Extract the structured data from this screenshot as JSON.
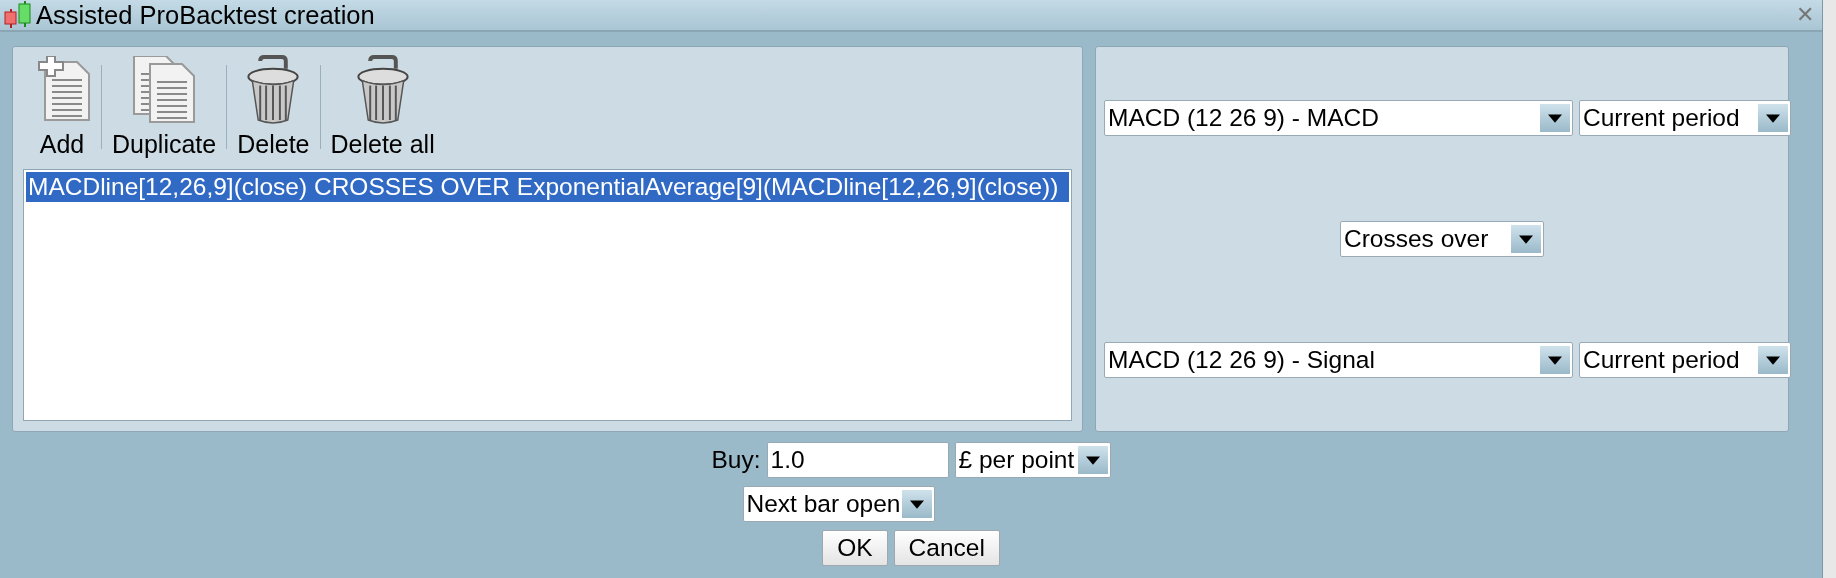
{
  "window": {
    "title": "Assisted ProBacktest creation",
    "close": "✕"
  },
  "toolbar": [
    {
      "kind": "add",
      "label": "Add"
    },
    {
      "kind": "duplicate",
      "label": "Duplicate"
    },
    {
      "kind": "delete",
      "label": "Delete"
    },
    {
      "kind": "delete_all",
      "label": "Delete all"
    }
  ],
  "conditions": [
    {
      "text": "MACDline[12,26,9](close) CROSSES OVER ExponentialAverage[9](MACDline[12,26,9](close))",
      "selected": true
    }
  ],
  "editor": {
    "first_operand": {
      "indicator": "MACD (12 26 9) - MACD",
      "period": "Current period"
    },
    "operator": "Crosses over",
    "second_operand": {
      "indicator": "MACD (12 26 9) - Signal",
      "period": "Current period"
    }
  },
  "order": {
    "label": "Buy:",
    "quantity": "1.0",
    "unit": "£ per point",
    "timing": "Next bar open"
  },
  "buttons": [
    "OK",
    "Cancel"
  ]
}
